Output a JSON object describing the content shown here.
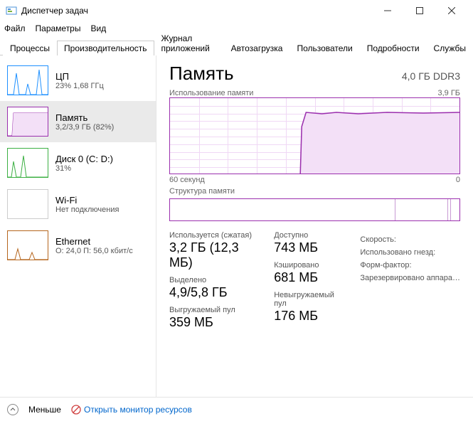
{
  "window": {
    "title": "Диспетчер задач"
  },
  "menu": {
    "file": "Файл",
    "options": "Параметры",
    "view": "Вид"
  },
  "tabs": {
    "processes": "Процессы",
    "performance": "Производительность",
    "app_history": "Журнал приложений",
    "startup": "Автозагрузка",
    "users": "Пользователи",
    "details": "Подробности",
    "services": "Службы"
  },
  "sidebar": [
    {
      "title": "ЦП",
      "sub": "23% 1,68 ГГц",
      "color": "#1e90ff"
    },
    {
      "title": "Память",
      "sub": "3,2/3,9 ГБ (82%)",
      "color": "#9b2fae",
      "selected": true
    },
    {
      "title": "Диск 0 (C: D:)",
      "sub": "31%",
      "color": "#3cb043"
    },
    {
      "title": "Wi-Fi",
      "sub": "Нет подключения",
      "color": "#bbb"
    },
    {
      "title": "Ethernet",
      "sub": "О: 24,0 П: 56,0 кбит/с",
      "color": "#b5651d"
    }
  ],
  "main": {
    "title": "Память",
    "subtitle": "4,0 ГБ DDR3",
    "usage_label": "Использование памяти",
    "usage_max": "3,9 ГБ",
    "axis_left": "60 секунд",
    "axis_right": "0",
    "composition_label": "Структура памяти",
    "stats": {
      "in_use_label": "Используется (сжатая)",
      "in_use_value": "3,2 ГБ (12,3 МБ)",
      "available_label": "Доступно",
      "available_value": "743 МБ",
      "committed_label": "Выделено",
      "committed_value": "4,9/5,8 ГБ",
      "cached_label": "Кэшировано",
      "cached_value": "681 МБ",
      "paged_label": "Выгружаемый пул",
      "paged_value": "359 МБ",
      "nonpaged_label": "Невыгружаемый пул",
      "nonpaged_value": "176 МБ"
    },
    "right": {
      "speed": "Скорость:",
      "slots": "Использовано гнезд:",
      "form": "Форм-фактор:",
      "reserved": "Зарезервировано аппара…"
    }
  },
  "footer": {
    "fewer": "Меньше",
    "open_monitor": "Открыть монитор ресурсов"
  },
  "chart_data": {
    "type": "area",
    "title": "Использование памяти",
    "ylabel": "ГБ",
    "ylim": [
      0,
      3.9
    ],
    "xlim_seconds": [
      60,
      0
    ],
    "series": [
      {
        "name": "Память",
        "color": "#9b2fae",
        "x": [
          60,
          55,
          50,
          45,
          40,
          35,
          33,
          32,
          31,
          30,
          25,
          20,
          15,
          10,
          5,
          0
        ],
        "y": [
          0,
          0,
          0,
          0,
          0,
          0,
          0,
          2.5,
          3.15,
          3.2,
          3.18,
          3.2,
          3.18,
          3.2,
          3.19,
          3.2
        ]
      }
    ]
  }
}
